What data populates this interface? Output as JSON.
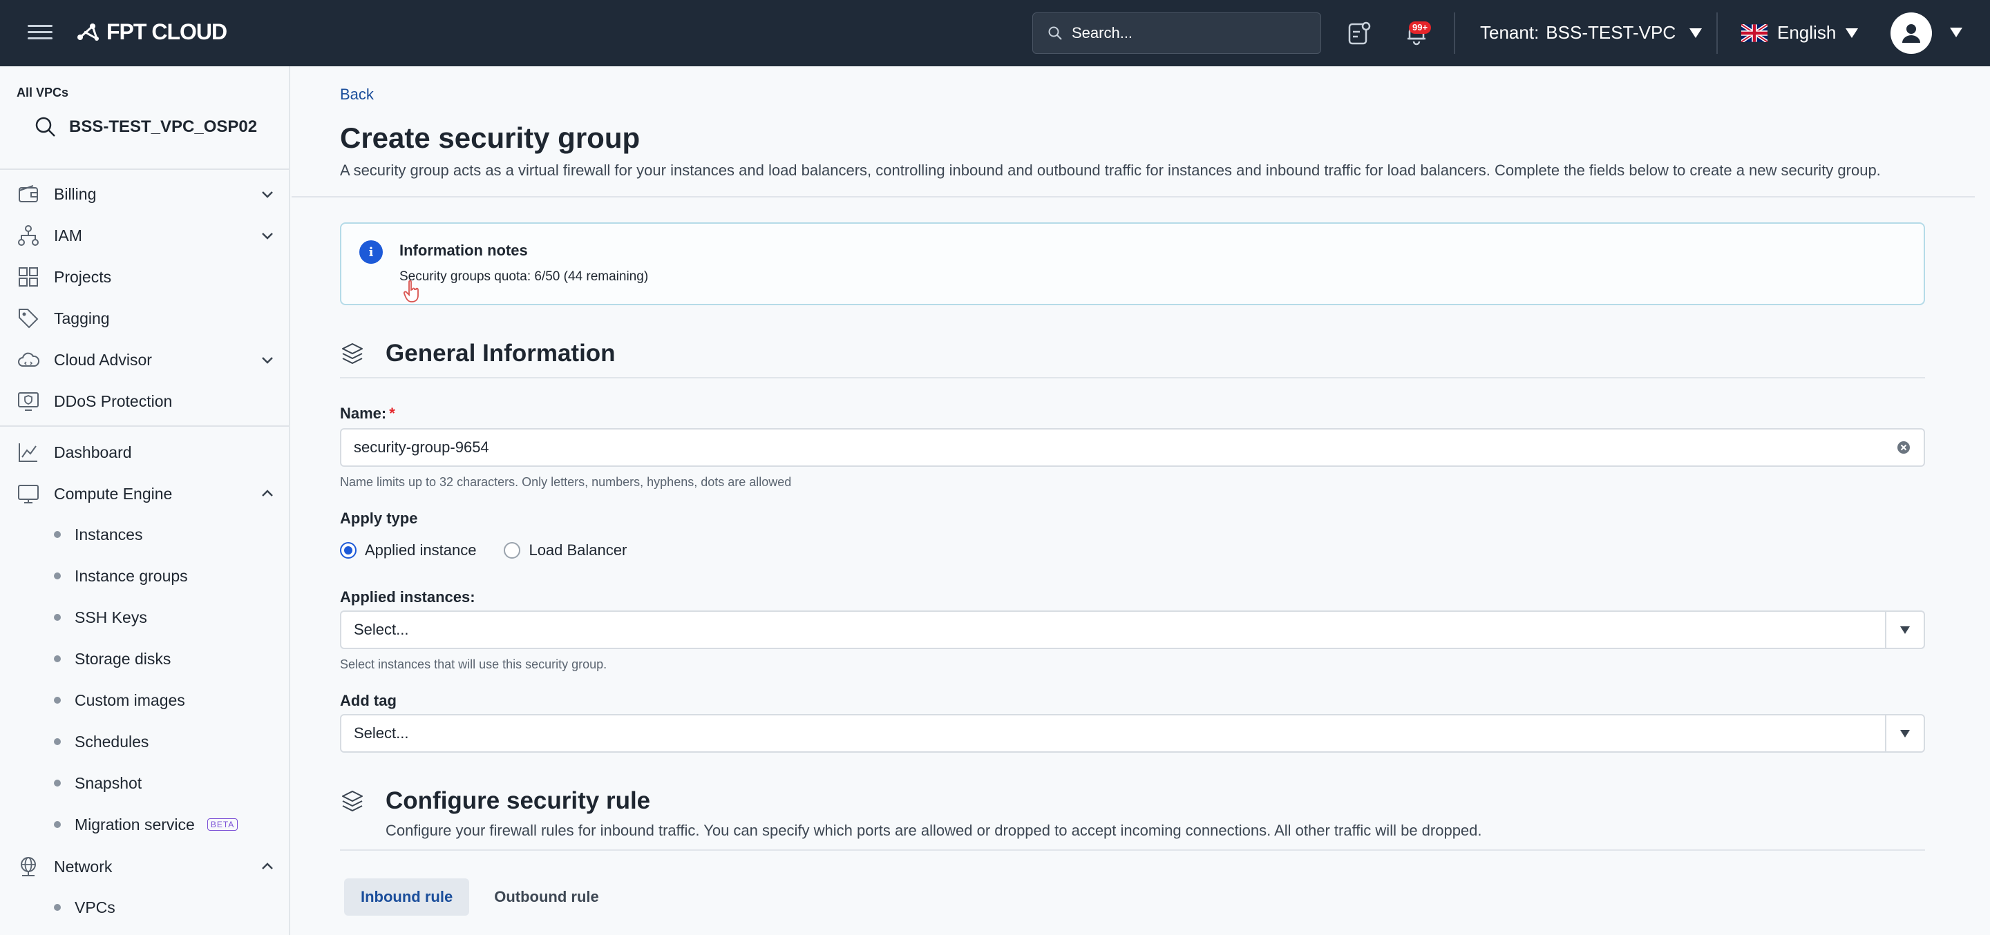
{
  "topbar": {
    "brand": "FPT CLOUD",
    "search_placeholder": "Search...",
    "notification_count": "99+",
    "tenant_label": "Tenant:",
    "tenant_value": "BSS-TEST-VPC",
    "language": "English"
  },
  "sidebar": {
    "all_vpcs": "All VPCs",
    "vpc_name": "BSS-TEST_VPC_OSP02",
    "items": [
      {
        "label": "Billing",
        "icon": "wallet-icon",
        "expandable": true,
        "expanded": false
      },
      {
        "label": "IAM",
        "icon": "hierarchy-icon",
        "expandable": true,
        "expanded": false
      },
      {
        "label": "Projects",
        "icon": "grid-icon",
        "expandable": false
      },
      {
        "label": "Tagging",
        "icon": "tag-icon",
        "expandable": false
      },
      {
        "label": "Cloud Advisor",
        "icon": "cloud-icon",
        "expandable": true,
        "expanded": false
      },
      {
        "label": "DDoS Protection",
        "icon": "shield-monitor-icon",
        "expandable": false
      }
    ],
    "items2": [
      {
        "label": "Dashboard",
        "icon": "chart-icon",
        "expandable": false
      },
      {
        "label": "Compute Engine",
        "icon": "monitor-icon",
        "expandable": true,
        "expanded": true
      }
    ],
    "compute_subitems": [
      "Instances",
      "Instance groups",
      "SSH Keys",
      "Storage disks",
      "Custom images",
      "Schedules",
      "Snapshot",
      "Migration service"
    ],
    "beta_label": "BETA",
    "network": {
      "label": "Network",
      "icon": "globe-icon",
      "expanded": true
    },
    "network_subitems": [
      "VPCs"
    ]
  },
  "main": {
    "back": "Back",
    "title": "Create security group",
    "description": "A security group acts as a virtual firewall for your instances and load balancers, controlling inbound and outbound traffic for instances and inbound traffic for load balancers. Complete the fields below to create a new security group.",
    "info": {
      "title": "Information notes",
      "text": "Security groups quota: 6/50 (44 remaining)"
    },
    "general": {
      "title": "General Information",
      "name_label": "Name:",
      "required_mark": "*",
      "name_value": "security-group-9654",
      "name_hint": "Name limits up to 32 characters. Only letters, numbers, hyphens, dots are allowed",
      "apply_type_label": "Apply type",
      "apply_options": [
        "Applied instance",
        "Load Balancer"
      ],
      "apply_selected": "Applied instance",
      "applied_instances_label": "Applied instances:",
      "applied_instances_value": "Select...",
      "applied_instances_hint": "Select instances that will use this security group.",
      "add_tag_label": "Add tag",
      "add_tag_value": "Select..."
    },
    "rules": {
      "title": "Configure security rule",
      "description": "Configure your firewall rules for inbound traffic. You can specify which ports are allowed or dropped to accept incoming connections. All other traffic will be dropped.",
      "tabs": [
        "Inbound rule",
        "Outbound rule"
      ],
      "active_tab": "Inbound rule"
    }
  },
  "colors": {
    "topbar_bg": "#1f2a38",
    "accent": "#1d5ad8",
    "link": "#1b4e9b",
    "badge": "#e5252a"
  }
}
